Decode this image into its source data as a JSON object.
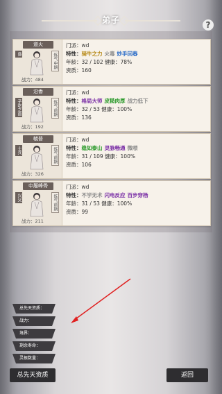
{
  "title": "弟子",
  "help_icon": "?",
  "colors": {
    "gold": "#b78a18",
    "blue": "#2a6cc8",
    "green": "#2e9b2e",
    "purple": "#7a2fa6",
    "gray": "#8c8c8c",
    "red": "#d62020"
  },
  "labels": {
    "sect": "门派：",
    "traits": "特性：",
    "age": "年龄：",
    "health": "健康：",
    "aptitude": "资质：",
    "power": "战力："
  },
  "disciples": [
    {
      "name": "道火",
      "side_tag": "炼气中期",
      "rank_tag": "昏",
      "power": "484",
      "sect": "wd",
      "traits": [
        {
          "text": "骑牛之力",
          "color": "#b78a18"
        },
        {
          "text": "火毒",
          "color": "#8c8c8c"
        },
        {
          "text": "妙手回春",
          "color": "#2a6cc8"
        }
      ],
      "age": "32 / 102",
      "health": "78%",
      "aptitude": "160"
    },
    {
      "name": "沿香",
      "side_tag": "炼气前期",
      "rank_tag": "子吃之首",
      "power": "192",
      "sect": "wd",
      "traits": [
        {
          "text": "格局大师",
          "color": "#7a2fa6"
        },
        {
          "text": "皮糙肉厚",
          "color": "#2e9b2e"
        },
        {
          "text": "战力低下",
          "color": "#8c8c8c"
        }
      ],
      "age": "32 / 53",
      "health": "100%",
      "aptitude": "136"
    },
    {
      "name": "毓普",
      "side_tag": "炼气前期",
      "rank_tag": "士兵",
      "power": "326",
      "sect": "wd",
      "traits": [
        {
          "text": "稳如泰山",
          "color": "#2e9b2e"
        },
        {
          "text": "灵脉畅通",
          "color": "#7a2fa6"
        },
        {
          "text": "微噤",
          "color": "#8c8c8c"
        }
      ],
      "age": "31 / 109",
      "health": "100%",
      "aptitude": "106"
    },
    {
      "name": "中履峰骨",
      "side_tag": "炼气前期",
      "rank_tag": "兴父",
      "power": "211",
      "sect": "wd",
      "traits": [
        {
          "text": "不学无术",
          "color": "#8c8c8c"
        },
        {
          "text": "闪电反应",
          "color": "#7a2fa6"
        },
        {
          "text": "百步穿杨",
          "color": "#7a2fa6"
        }
      ],
      "age": "31 / 53",
      "health": "100%",
      "aptitude": "99"
    }
  ],
  "side_menu": [
    "总先天资质",
    "战力",
    "境界",
    "剩余寿命",
    "灵根数量"
  ],
  "side_label": "总先天资质",
  "back_label": "返回"
}
